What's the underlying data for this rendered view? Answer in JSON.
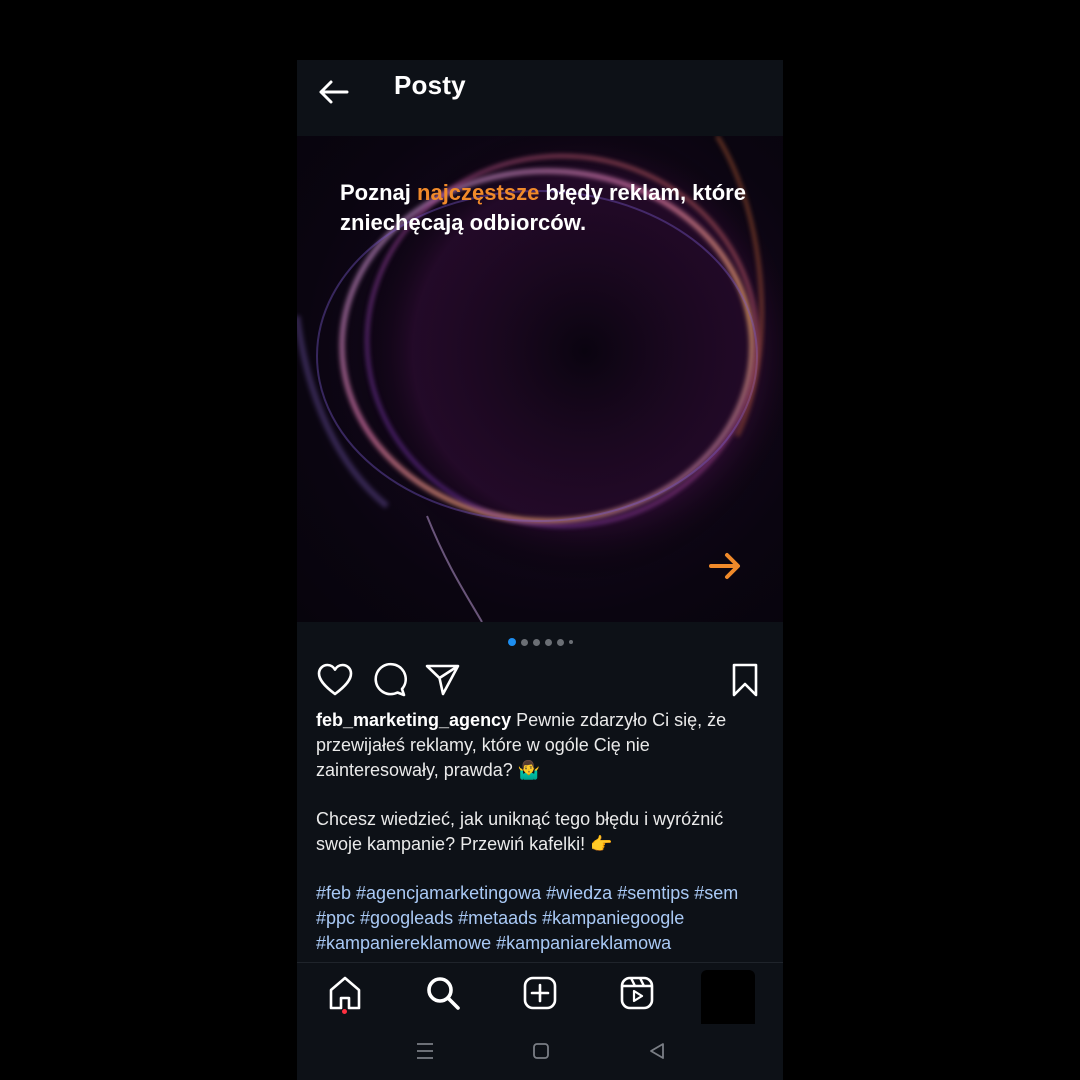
{
  "header": {
    "title": "Posty"
  },
  "post": {
    "headline_before": "Poznaj ",
    "headline_accent": "najczęstsze",
    "headline_after": " błędy reklam, które zniechęcają odbiorców.",
    "accent_color": "#f08a2a",
    "carousel": {
      "total_slides": 6,
      "current_slide": 1
    },
    "caption": {
      "username": "feb_marketing_agency",
      "line1": " Pewnie zdarzyło Ci się, że przewijałeś reklamy, które w ogóle Cię nie zainteresowały, prawda? 🤷‍♂️",
      "line2": "Chcesz wiedzieć, jak uniknąć tego błędu i wyróżnić swoje kampanie? Przewiń kafelki! 👉",
      "hashtags": "#feb #agencjamarketingowa #wiedza #semtips #sem #ppc #googleads #metaads #kampaniegoogle #kampaniereklamowe #kampaniareklamowa"
    }
  },
  "icons": {
    "back": "arrow-left-icon",
    "like": "heart-icon",
    "comment": "comment-icon",
    "share": "send-icon",
    "save": "bookmark-icon",
    "next": "arrow-right-icon"
  },
  "bottom_nav": [
    "home-icon",
    "search-icon",
    "create-icon",
    "reels-icon",
    "profile-icon"
  ],
  "colors": {
    "background": "#0d1117",
    "link": "#a9c9f5",
    "active_dot": "#1d8ef0",
    "notification": "#ff3040"
  }
}
